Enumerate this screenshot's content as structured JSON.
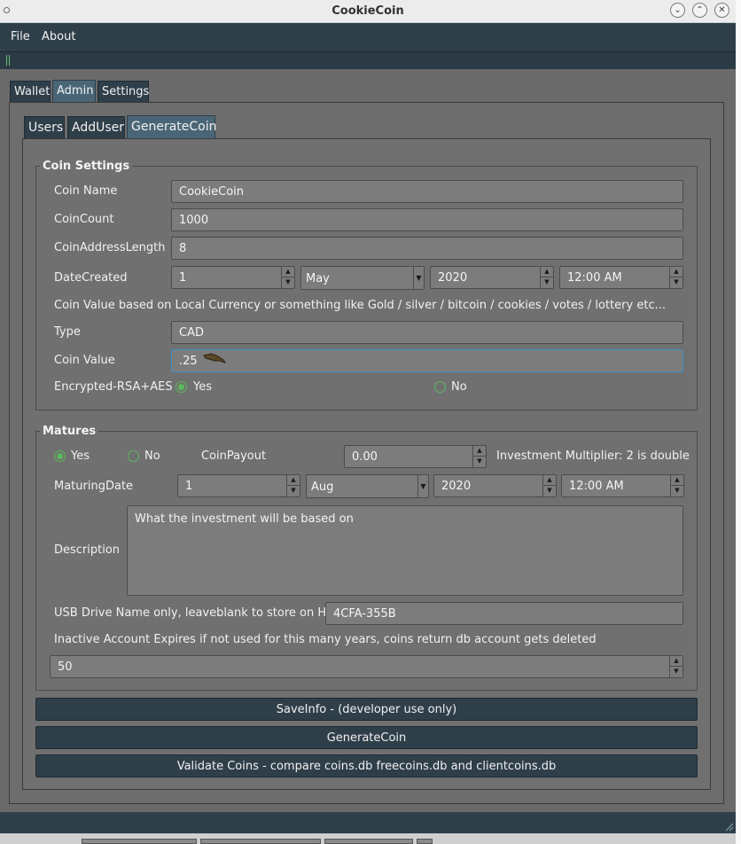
{
  "window": {
    "title": "CookieCoin"
  },
  "menu": {
    "file": "File",
    "about": "About"
  },
  "tabs": {
    "wallet": "Wallet",
    "admin": "Admin",
    "settings": "Settings"
  },
  "subtabs": {
    "users": "Users",
    "adduser": "AddUser",
    "generatecoin": "GenerateCoin"
  },
  "coin_settings": {
    "title": "Coin Settings",
    "coin_name_label": "Coin Name",
    "coin_name_value": "CookieCoin",
    "coin_count_label": "CoinCount",
    "coin_count_value": "1000",
    "address_length_label": "CoinAddressLength",
    "address_length_value": "8",
    "date_created_label": "DateCreated",
    "date_day": "1",
    "date_month": "May",
    "date_year": "2020",
    "date_time": "12:00 AM",
    "value_note": "Coin Value based on Local Currency or something like Gold / silver / bitcoin / cookies / votes / lottery etc...",
    "type_label": "Type",
    "type_value": "CAD",
    "coin_value_label": "Coin Value",
    "coin_value_value": ".25",
    "encrypted_label": "Encrypted-RSA+AES",
    "yes_label": "Yes",
    "no_label": "No",
    "encrypted_selected": "Yes"
  },
  "matures": {
    "title": "Matures",
    "yes_label": "Yes",
    "no_label": "No",
    "selected": "Yes",
    "payout_label": "CoinPayout",
    "payout_value": "0.00",
    "multiplier_note": "Investment Multiplier: 2 is double",
    "maturing_date_label": "MaturingDate",
    "date_day": "1",
    "date_month": "Aug",
    "date_year": "2020",
    "date_time": "12:00 AM",
    "description_label": "Description",
    "description_value": "What the investment will be based on",
    "usb_label": "USB Drive Name only, leaveblank to store on HD",
    "usb_value": "4CFA-355B",
    "inactive_note": "Inactive Account Expires if not used for this many years, coins return db account gets deleted",
    "inactive_years": "50"
  },
  "buttons": {
    "save_info": "SaveInfo - (developer use only)",
    "generate_coin": "GenerateCoin",
    "validate": "Validate Coins - compare coins.db freecoins.db and clientcoins.db"
  },
  "colors": {
    "accent": "#5cb85c",
    "bar": "#2f3f4a",
    "panel": "#6d6d6d",
    "focus": "#3d8ec9"
  }
}
